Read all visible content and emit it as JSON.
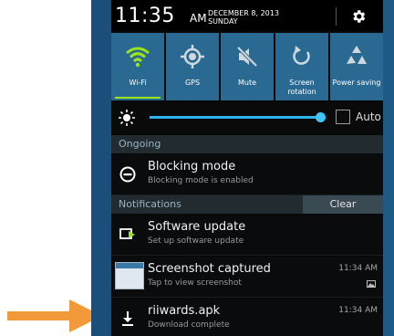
{
  "status": {
    "time": "11:35",
    "ampm": "AM",
    "date": "DECEMBER 8, 2013",
    "day": "SUNDAY",
    "settings_icon": "gear-icon"
  },
  "quick_settings": [
    {
      "label": "Wi-Fi",
      "icon": "wifi-icon",
      "active": true
    },
    {
      "label": "GPS",
      "icon": "gps-icon",
      "active": false
    },
    {
      "label": "Mute",
      "icon": "mute-icon",
      "active": false
    },
    {
      "label": "Screen rotation",
      "icon": "rotation-icon",
      "active": false
    },
    {
      "label": "Power saving",
      "icon": "recycle-icon",
      "active": false
    }
  ],
  "brightness": {
    "auto_label": "Auto",
    "level": 0.95
  },
  "ongoing": {
    "header": "Ongoing",
    "item": {
      "title": "Blocking mode",
      "subtitle": "Blocking mode is enabled"
    }
  },
  "notifications": {
    "header": "Notifications",
    "clear_label": "Clear",
    "items": [
      {
        "title": "Software update",
        "subtitle": "Set up software update",
        "time": ""
      },
      {
        "title": "Screenshot captured",
        "subtitle": "Tap to view screenshot",
        "time": "11:34 AM"
      },
      {
        "title": "riiwards.apk",
        "subtitle": "Download complete",
        "time": "11:34 AM"
      }
    ]
  },
  "colors": {
    "accent": "#2fb5ea",
    "wifi_active": "#9be31a",
    "tile": "#2a6a92",
    "arrow": "#f29a3a"
  }
}
